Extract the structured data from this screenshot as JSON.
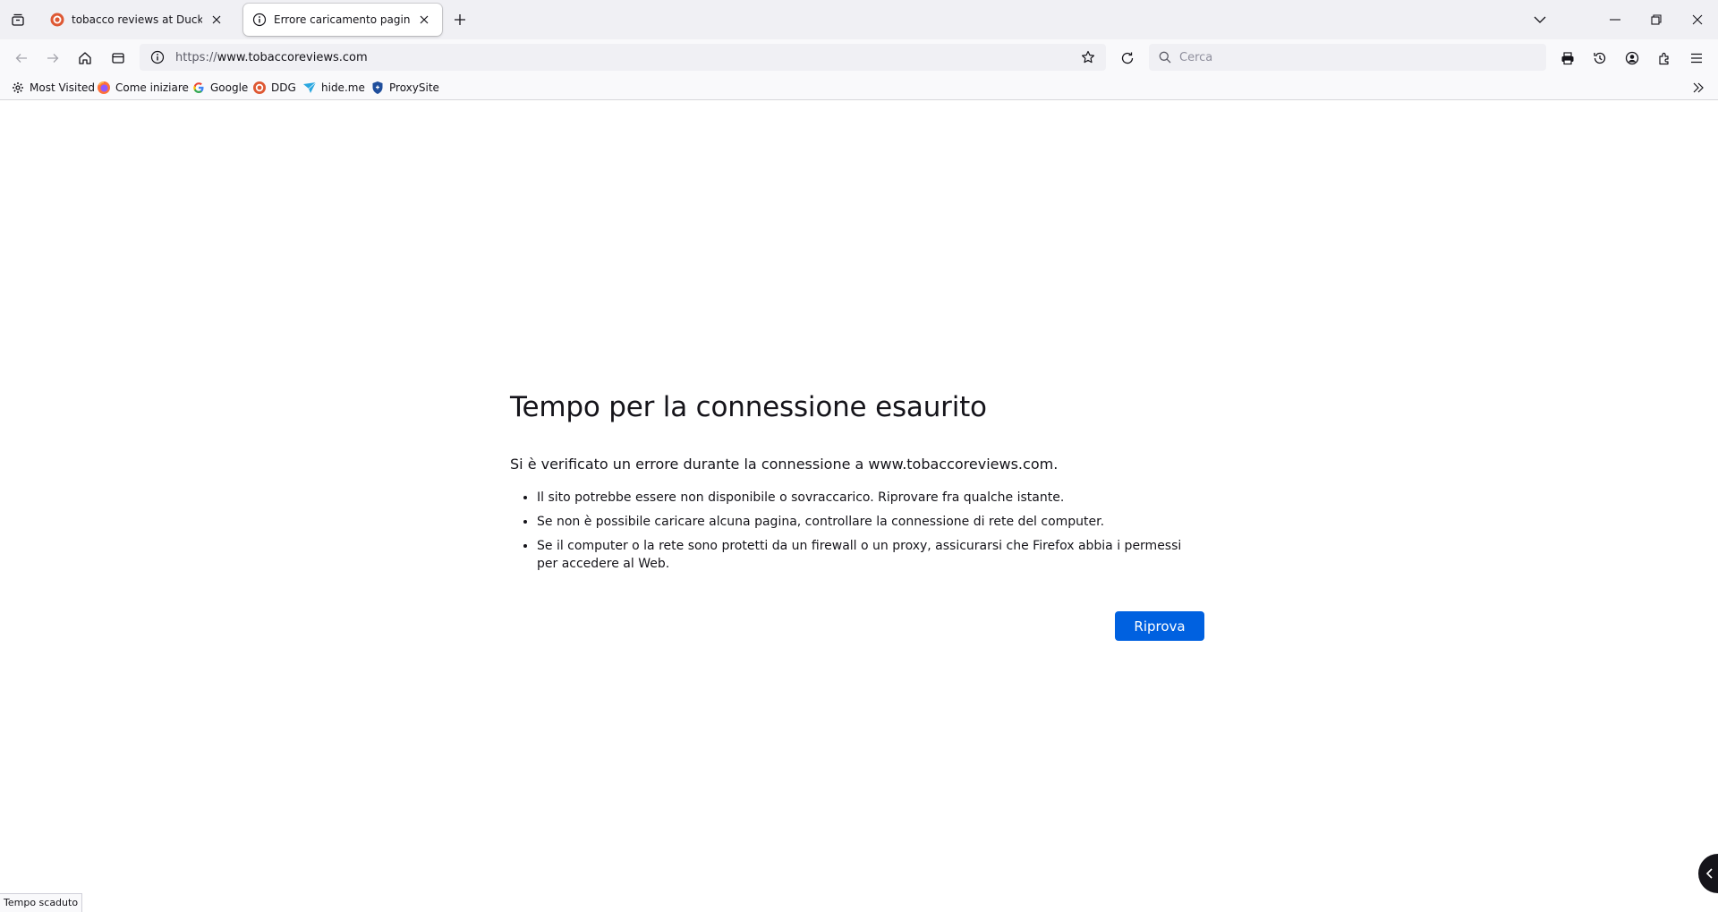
{
  "tabs": [
    {
      "title": "tobacco reviews at DuckDuckGo",
      "favicon": "duckduckgo-icon",
      "active": false
    },
    {
      "title": "Errore caricamento pagina",
      "favicon": "info-icon",
      "active": true
    }
  ],
  "navbar": {
    "url_protocol": "https://",
    "url_host": "www.tobaccoreviews.com",
    "search_placeholder": "Cerca"
  },
  "bookmarks": [
    {
      "label": "Most Visited",
      "icon": "gear-icon"
    },
    {
      "label": "Come iniziare",
      "icon": "firefox-icon"
    },
    {
      "label": "Google",
      "icon": "google-icon"
    },
    {
      "label": "DDG",
      "icon": "duckduckgo-icon"
    },
    {
      "label": "hide.me",
      "icon": "hideme-icon"
    },
    {
      "label": "ProxySite",
      "icon": "shield-icon"
    }
  ],
  "error": {
    "title": "Tempo per la connessione esaurito",
    "description": "Si è verificato un errore durante la connessione a www.tobaccoreviews.com.",
    "items": [
      "Il sito potrebbe essere non disponibile o sovraccarico. Riprovare fra qualche istante.",
      "Se non è possibile caricare alcuna pagina, controllare la connessione di rete del computer.",
      "Se il computer o la rete sono protetti da un firewall o un proxy, assicurarsi che Firefox abbia i permessi per accedere al Web."
    ],
    "retry_label": "Riprova"
  },
  "status_text": "Tempo scaduto",
  "colors": {
    "accent": "#0061e0",
    "tabbar": "#f0f0f4",
    "toolbar": "#f9f9fb"
  }
}
